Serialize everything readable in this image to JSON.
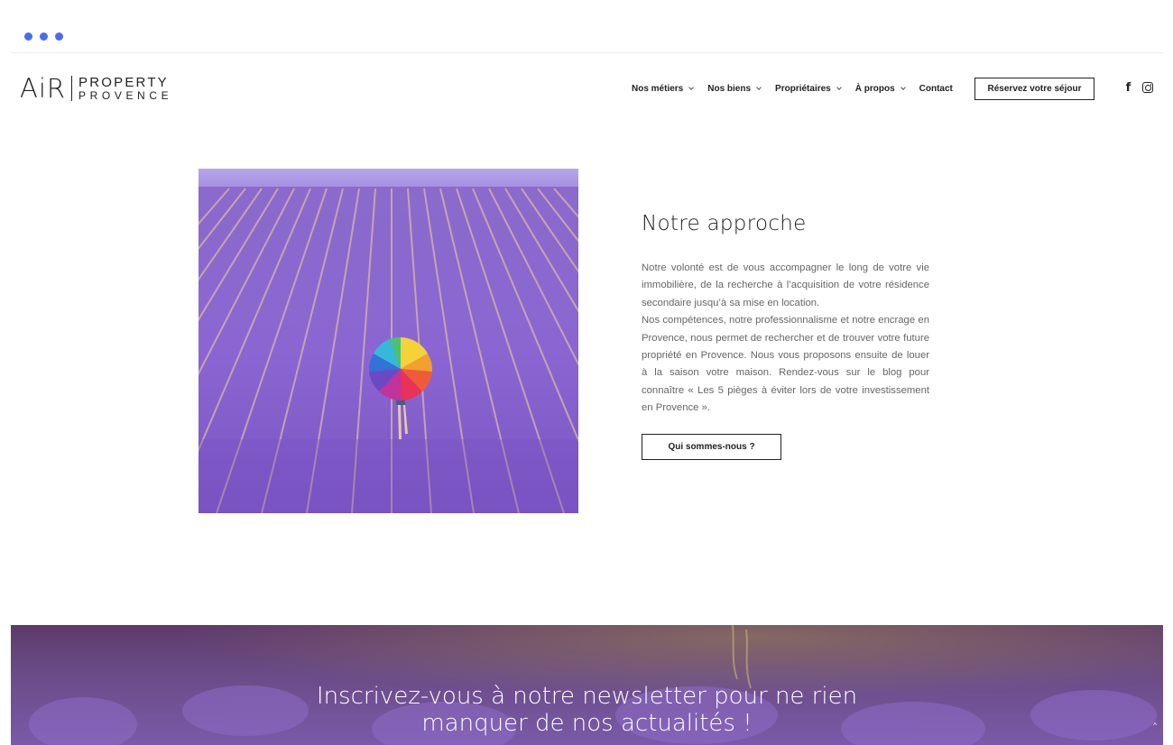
{
  "brand": {
    "logo_main": "AiR",
    "logo_line1": "PROPERTY",
    "logo_line2": "PROVENCE"
  },
  "nav": {
    "items": [
      {
        "label": "Nos métiers"
      },
      {
        "label": "Nos biens"
      },
      {
        "label": "Propriétaires"
      },
      {
        "label": "À propos"
      }
    ],
    "contact": "Contact",
    "cta": "Réservez votre séjour"
  },
  "social": {
    "facebook_glyph": "f"
  },
  "approach": {
    "title": "Notre approche",
    "paragraph1": "Notre volonté est de vous accompagner le long de votre vie immobilière, de la recherche à l’acquisition de votre résidence secondaire jusqu’à sa mise en location.",
    "paragraph2": "Nos compétences, notre professionnalisme et notre encrage en Provence, nous permet de rechercher et de trouver votre future propriété en Provence. Nous vous proposons ensuite de louer à la saison votre maison. Rendez-vous sur le blog pour connaître « Les 5 pièges à éviter lors de votre investissement en Provence ».",
    "button": "Qui sommes-nous ?"
  },
  "newsletter": {
    "line1": "Inscrivez-vous à notre newsletter pour ne rien",
    "line2": "manquer de nos actualités !"
  },
  "colors": {
    "accent_dots": "#4a6cf0",
    "lavender": "#8c6fd0",
    "text": "#222222"
  }
}
